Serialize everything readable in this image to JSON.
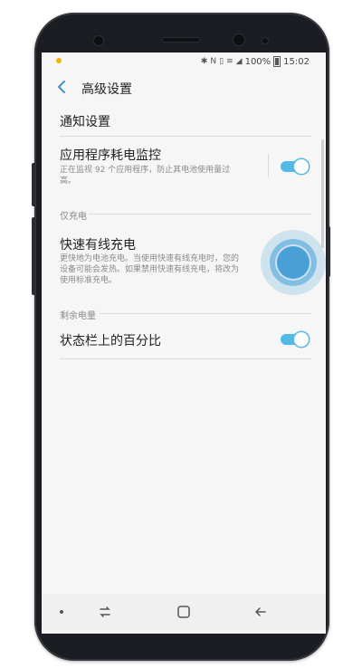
{
  "status_bar": {
    "battery_percent": "100%",
    "time": "15:02",
    "icons": [
      "notification-dot",
      "bluetooth-icon",
      "nfc-icon",
      "vibrate-icon",
      "wifi-icon",
      "signal-icon",
      "battery-icon"
    ]
  },
  "app_bar": {
    "title": "高级设置",
    "back_icon": "back-arrow-icon"
  },
  "settings": {
    "notification_settings": {
      "label": "通知设置"
    },
    "app_power_monitor": {
      "title": "应用程序耗电监控",
      "desc_line1": "正在监视 92 个应用程序，防止其电池使用量过",
      "desc_line2": "高。",
      "enabled": true
    },
    "charging_only_header": "仅充电",
    "fast_wired_charging": {
      "title": "快速有线充电",
      "desc_line1": "更快地为电池充电。当使用快速有线充电时，您的",
      "desc_line2": "设备可能会发热。如果禁用快速有线充电，将改为",
      "desc_line3": "使用标准充电。",
      "enabled": true
    },
    "remaining_battery_header": "剩余电量",
    "battery_percentage_statusbar": {
      "title": "状态栏上的百分比",
      "enabled": true
    }
  },
  "nav_bar": {
    "items": [
      "dot-icon",
      "recent-apps-icon",
      "home-icon",
      "back-icon"
    ]
  },
  "colors": {
    "toggle_on": "#53b9e6",
    "background": "#f6f6f6",
    "tap_indicator": "#4a9fd6"
  }
}
